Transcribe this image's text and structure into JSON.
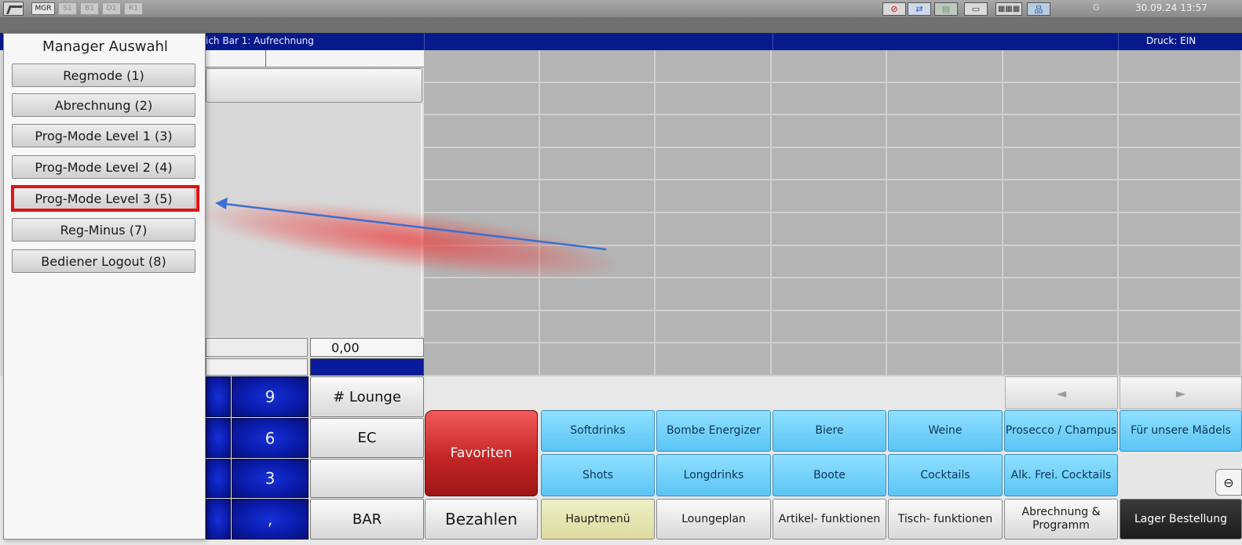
{
  "topbar": {
    "modes": [
      "MGR",
      "S1",
      "B1",
      "D1",
      "R1"
    ],
    "active_mode": "MGR",
    "terminal_letter": "G",
    "datetime": "30.09.24  13:57",
    "tray_icons": [
      "no-entry-icon",
      "network-icon",
      "folder-icon",
      "monitor-icon",
      "keyboard-icon",
      "hierarchy-icon"
    ]
  },
  "header": {
    "title": "ich Bar 1: Aufrechnung",
    "print_status": "Druck: EIN"
  },
  "receipt": {
    "total": "0,00"
  },
  "keypad": {
    "keys": [
      "9",
      "6",
      "3",
      ","
    ],
    "functions": [
      "# Lounge",
      "EC",
      "",
      "BAR"
    ]
  },
  "navigation": {
    "left_arrow": "◄",
    "right_arrow": "►"
  },
  "categories": {
    "favorites": "Favoriten",
    "row1": [
      "Softdrinks",
      "Bombe Energizer",
      "Biere",
      "Weine",
      "Prosecco / Champus",
      "Für unsere Mädels"
    ],
    "row2": [
      "Shots",
      "Longdrinks",
      "Boote",
      "Cocktails",
      "Alk. Frei. Cocktails"
    ]
  },
  "bottom_bar": {
    "bezahlen": "Bezahlen",
    "items": [
      "Hauptmenü",
      "Loungeplan",
      "Artikel- funktionen",
      "Tisch- funktionen",
      "Abrechnung & Programm",
      "Lager Bestellung"
    ]
  },
  "manager_menu": {
    "title": "Manager Auswahl",
    "items": [
      "Regmode (1)",
      "Abrechnung (2)",
      "Prog-Mode Level 1 (3)",
      "Prog-Mode Level 2 (4)",
      "Prog-Mode Level 3 (5)",
      "Reg-Minus (7)",
      "Bediener Logout (8)"
    ],
    "highlighted_item": "Prog-Mode Level 3 (5)"
  },
  "side_tab_icon": "collapse-icon",
  "colors": {
    "header_blue": "#061a8c",
    "keypad_blue": "#0a1aa8",
    "favorites_red": "#c42626",
    "category_cyan": "#5cc4f5",
    "highlight_red": "#e11212",
    "arrow_blue": "#3b6fd1"
  }
}
